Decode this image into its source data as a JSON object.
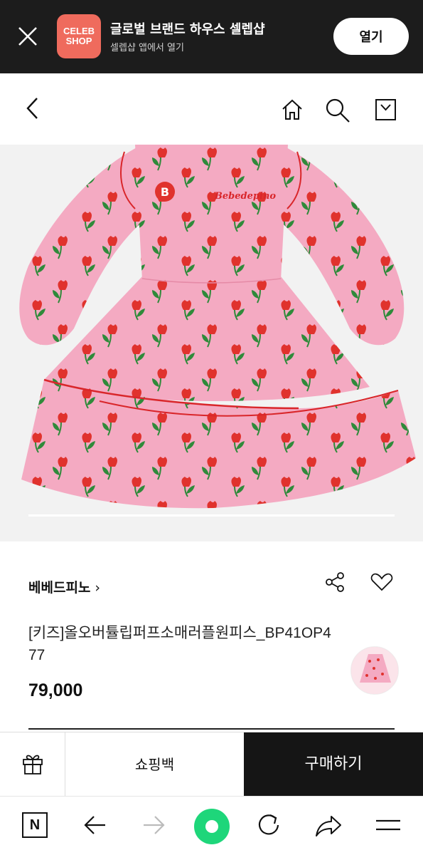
{
  "banner": {
    "logo_line1": "CELEB",
    "logo_line2": "SHOP",
    "title": "글로벌 브랜드 하우스 셀렙샵",
    "subtitle": "셀렙샵 앱에서 열기",
    "open_label": "열기",
    "logo_color": "#ef6b5d"
  },
  "nav": {
    "icons": [
      "back-icon",
      "home-icon",
      "search-icon",
      "shopping-bag-icon"
    ]
  },
  "product": {
    "brand": "베베드피노",
    "brand_chevron": "›",
    "name_line1": "[키즈]올오버튤립퍼프소매러플원피스_BP41OP4",
    "name_line2": "77",
    "price": "79,000",
    "image_embroidery": "Bebedepino",
    "badge_letter": "B"
  },
  "actions": {
    "shopping_bag": "쇼핑백",
    "buy": "구매하기"
  },
  "browser": {
    "tab_letter": "N",
    "accent": "#1ed67a"
  }
}
